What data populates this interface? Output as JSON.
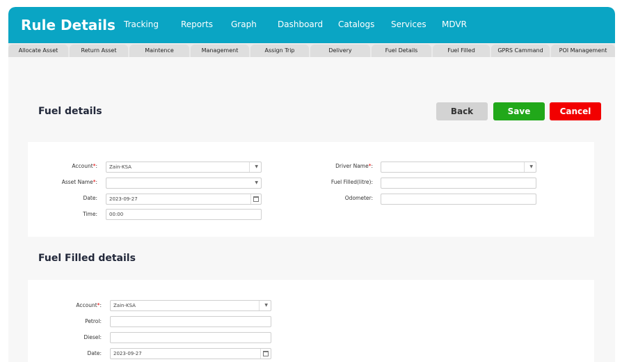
{
  "header": {
    "title": "Rule Details",
    "nav": [
      "Tracking",
      "Reports",
      "Graph",
      "Dashboard",
      "Catalogs",
      "Services",
      "MDVR"
    ]
  },
  "subnav": [
    "Allocate Asset",
    "Return Asset",
    "Maintence",
    "Management",
    "Assign Trip",
    "Delivery",
    "Fuel Details",
    "Fuel Filled",
    "GPRS Cammand",
    "POI Management"
  ],
  "fuel_details": {
    "title": "Fuel details",
    "buttons": {
      "back": "Back",
      "save": "Save",
      "cancel": "Cancel"
    },
    "account_label": "Account",
    "account_value": "Zain-KSA",
    "asset_label": "Asset Name",
    "asset_value": "",
    "date_label": "Date:",
    "date_value": "2023-09-27",
    "time_label": "Time:",
    "time_value": "00:00",
    "driver_label": "Driver Name",
    "driver_value": "",
    "fuel_filled_label": "Fuel Filled(litre):",
    "fuel_filled_value": "",
    "odometer_label": "Odometer:",
    "odometer_value": ""
  },
  "fuel_filled_details": {
    "title": "Fuel Filled details",
    "account_label": "Account",
    "account_value": "Zain-KSA",
    "petrol_label": "Petrol:",
    "petrol_value": "",
    "diesel_label": "Diesel:",
    "diesel_value": "",
    "date_label": "Date:",
    "date_value": "2023-09-27"
  },
  "required_mark": "*",
  "colors": {
    "header": "#0aa5c4",
    "save": "#21a81a",
    "cancel": "#f20000",
    "back": "#d3d3d3"
  }
}
